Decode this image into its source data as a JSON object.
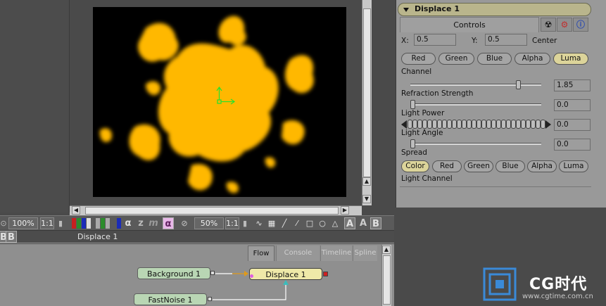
{
  "viewer": {
    "zoom_left": "100%",
    "ratio_left": "1:1",
    "zoom_right": "50%",
    "ratio_right": "1:1",
    "status_label": "Displace 1",
    "left_labels": [
      "B",
      "B"
    ],
    "toolbar_glyphs": [
      "α",
      "z",
      "m",
      "α",
      "A",
      "A",
      "B"
    ],
    "image_color": "#ffb800"
  },
  "flow": {
    "tabs": [
      "Flow",
      "Console",
      "Timeline",
      "Spline"
    ],
    "nodes": {
      "background": "Background 1",
      "displace": "Displace 1",
      "fastnoise": "FastNoise 1"
    }
  },
  "panel": {
    "title": "Displace 1",
    "tab_controls": "Controls",
    "center": {
      "x_label": "X:",
      "x_value": "0.5",
      "y_label": "Y:",
      "y_value": "0.5",
      "suffix": "Center"
    },
    "channel_buttons": [
      "Red",
      "Green",
      "Blue",
      "Alpha",
      "Luma"
    ],
    "channel_selected": "Luma",
    "channel_label": "Channel",
    "refraction_value": "1.85",
    "refraction_level": 0.82,
    "refraction_label": "Refraction Strength",
    "light_power_value": "0.0",
    "light_power_label": "Light Power",
    "light_angle_value": "0.0",
    "light_angle_label": "Light Angle",
    "spread_value": "0.0",
    "spread_label": "Spread",
    "light_channel_buttons": [
      "Color",
      "Red",
      "Green",
      "Blue",
      "Alpha",
      "Luma"
    ],
    "light_channel_selected": "Color",
    "light_channel_label": "Light Channel"
  },
  "watermark": {
    "brand": "CG时代",
    "url": "www.cgtime.com.cn"
  },
  "colors": {
    "accent": "#dcd49a",
    "node_green": "#b9d6b4",
    "node_yellow": "#efe9a8"
  }
}
